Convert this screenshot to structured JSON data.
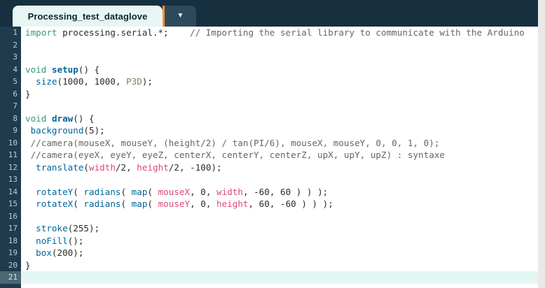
{
  "colors": {
    "header_bg": "#16303f",
    "tab_bg": "#e7f6f3",
    "accent_orange": "#ff9533",
    "gutter_bg": "#1f3c4d",
    "current_line_bg": "#e3f6f3",
    "keyword_green": "#33997e",
    "function_blue": "#006699",
    "variable_pink": "#d94a7a",
    "constant_olive": "#718a62",
    "comment_gray": "#666666"
  },
  "tab_bar": {
    "tab_label": "Processing_test_dataglove",
    "dropdown_icon": "▼"
  },
  "editor": {
    "current_line": 21,
    "lines": [
      {
        "num": 1,
        "segments": [
          [
            "k",
            "import"
          ],
          [
            "p",
            " processing.serial.*;    "
          ],
          [
            "cm",
            "// Importing the serial library to communicate with the Arduino"
          ]
        ]
      },
      {
        "num": 2,
        "segments": []
      },
      {
        "num": 3,
        "segments": []
      },
      {
        "num": 4,
        "segments": [
          [
            "k",
            "void"
          ],
          [
            "p",
            " "
          ],
          [
            "fb",
            "setup"
          ],
          [
            "p",
            "() {"
          ]
        ]
      },
      {
        "num": 5,
        "segments": [
          [
            "p",
            "  "
          ],
          [
            "f",
            "size"
          ],
          [
            "p",
            "(1000, 1000, "
          ],
          [
            "c",
            "P3D"
          ],
          [
            "p",
            ");"
          ]
        ]
      },
      {
        "num": 6,
        "segments": [
          [
            "p",
            "}"
          ]
        ]
      },
      {
        "num": 7,
        "segments": []
      },
      {
        "num": 8,
        "segments": [
          [
            "k",
            "void"
          ],
          [
            "p",
            " "
          ],
          [
            "fb",
            "draw"
          ],
          [
            "p",
            "() {"
          ]
        ]
      },
      {
        "num": 9,
        "segments": [
          [
            "p",
            " "
          ],
          [
            "f",
            "background"
          ],
          [
            "p",
            "(5);"
          ]
        ]
      },
      {
        "num": 10,
        "segments": [
          [
            "p",
            " "
          ],
          [
            "cm",
            "//camera(mouseX, mouseY, (height/2) / tan(PI/6), mouseX, mouseY, 0, 0, 1, 0);"
          ]
        ]
      },
      {
        "num": 11,
        "segments": [
          [
            "p",
            " "
          ],
          [
            "cm",
            "//camera(eyeX, eyeY, eyeZ, centerX, centerY, centerZ, upX, upY, upZ) : syntaxe"
          ]
        ]
      },
      {
        "num": 12,
        "segments": [
          [
            "p",
            "  "
          ],
          [
            "f",
            "translate"
          ],
          [
            "p",
            "("
          ],
          [
            "v",
            "width"
          ],
          [
            "p",
            "/2, "
          ],
          [
            "v",
            "height"
          ],
          [
            "p",
            "/2, -100);"
          ]
        ]
      },
      {
        "num": 13,
        "segments": []
      },
      {
        "num": 14,
        "segments": [
          [
            "p",
            "  "
          ],
          [
            "f",
            "rotateY"
          ],
          [
            "p",
            "( "
          ],
          [
            "f",
            "radians"
          ],
          [
            "p",
            "( "
          ],
          [
            "f",
            "map"
          ],
          [
            "p",
            "( "
          ],
          [
            "v",
            "mouseX"
          ],
          [
            "p",
            ", 0, "
          ],
          [
            "v",
            "width"
          ],
          [
            "p",
            ", -60, 60 ) ) );"
          ]
        ]
      },
      {
        "num": 15,
        "segments": [
          [
            "p",
            "  "
          ],
          [
            "f",
            "rotateX"
          ],
          [
            "p",
            "( "
          ],
          [
            "f",
            "radians"
          ],
          [
            "p",
            "( "
          ],
          [
            "f",
            "map"
          ],
          [
            "p",
            "( "
          ],
          [
            "v",
            "mouseY"
          ],
          [
            "p",
            ", 0, "
          ],
          [
            "v",
            "height"
          ],
          [
            "p",
            ", 60, -60 ) ) );"
          ]
        ]
      },
      {
        "num": 16,
        "segments": []
      },
      {
        "num": 17,
        "segments": [
          [
            "p",
            "  "
          ],
          [
            "f",
            "stroke"
          ],
          [
            "p",
            "(255);"
          ]
        ]
      },
      {
        "num": 18,
        "segments": [
          [
            "p",
            "  "
          ],
          [
            "f",
            "noFill"
          ],
          [
            "p",
            "();"
          ]
        ]
      },
      {
        "num": 19,
        "segments": [
          [
            "p",
            "  "
          ],
          [
            "f",
            "box"
          ],
          [
            "p",
            "(200);"
          ]
        ]
      },
      {
        "num": 20,
        "segments": [
          [
            "p",
            "}"
          ]
        ]
      },
      {
        "num": 21,
        "segments": []
      }
    ]
  }
}
